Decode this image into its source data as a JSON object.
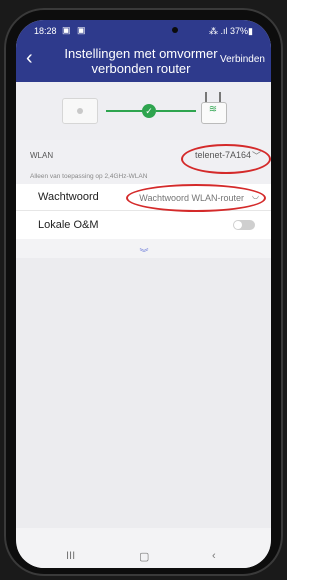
{
  "status": {
    "time": "18:28",
    "left_icons": "▣ ▣",
    "right": "⁂ .ıl 37%▮"
  },
  "header": {
    "back_icon": "‹",
    "title": "Instellingen met omvormer verbonden router",
    "connect": "Verbinden"
  },
  "diagram": {
    "check": "✓",
    "wifi": "≋"
  },
  "wlan": {
    "label": "WLAN",
    "value": "telenet-7A164",
    "chevron": "﹀",
    "note": "Alleen van toepassing op 2,4GHz-WLAN"
  },
  "password": {
    "label": "Wachtwoord",
    "placeholder": "Wachtwoord WLAN-router",
    "eye": "◡"
  },
  "om": {
    "label": "Lokale O&M"
  },
  "expand_icon": "︾",
  "nav": {
    "recents": "III",
    "home": "▢",
    "back": "‹"
  },
  "colors": {
    "header": "#2e3a8c",
    "accent": "#2ea44f",
    "highlight": "#d42a2a"
  }
}
